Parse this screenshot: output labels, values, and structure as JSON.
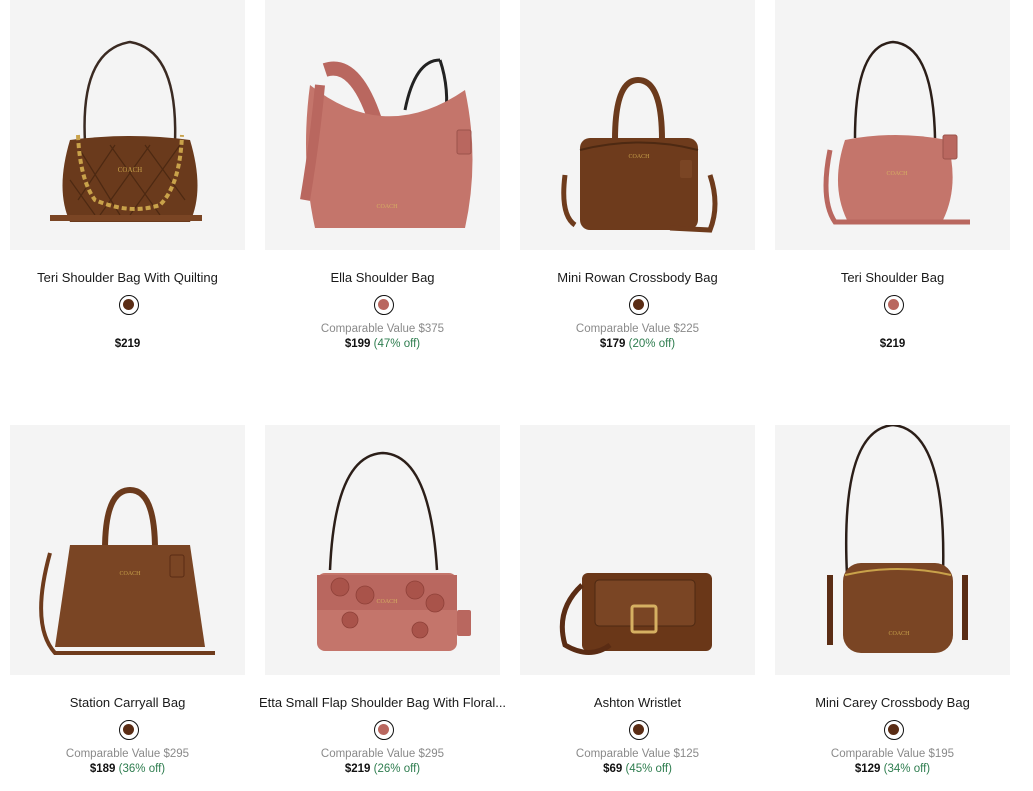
{
  "colors": {
    "tile_background": "#f4f4f4",
    "discount_text": "#2e7d4f",
    "compare_text": "#8a8a8a"
  },
  "products": [
    {
      "name": "Teri Shoulder Bag With Quilting",
      "swatch_color": "#5a2c14",
      "comparable_value": "",
      "price": "$219",
      "discount": "",
      "image": "brown-quilted-shoulder-bag-gold-chain"
    },
    {
      "name": "Ella Shoulder Bag",
      "swatch_color": "#b9675f",
      "comparable_value": "Comparable Value $375",
      "price": "$199",
      "discount": "(47% off)",
      "image": "pink-suede-hobo-shoulder-bag"
    },
    {
      "name": "Mini Rowan Crossbody Bag",
      "swatch_color": "#5a2c14",
      "comparable_value": "Comparable Value $225",
      "price": "$179",
      "discount": "(20% off)",
      "image": "brown-suede-barrel-crossbody-bag"
    },
    {
      "name": "Teri Shoulder Bag",
      "swatch_color": "#b9675f",
      "comparable_value": "",
      "price": "$219",
      "discount": "",
      "image": "pink-suede-shoulder-bag"
    },
    {
      "name": "Station Carryall Bag",
      "swatch_color": "#5a2c14",
      "comparable_value": "Comparable Value $295",
      "price": "$189",
      "discount": "(36% off)",
      "image": "brown-suede-carryall-tote"
    },
    {
      "name": "Etta Small Flap Shoulder Bag With Floral...",
      "swatch_color": "#b9675f",
      "comparable_value": "Comparable Value $295",
      "price": "$219",
      "discount": "(26% off)",
      "image": "pink-floral-applique-flap-bag"
    },
    {
      "name": "Ashton Wristlet",
      "swatch_color": "#5a2c14",
      "comparable_value": "Comparable Value $125",
      "price": "$69",
      "discount": "(45% off)",
      "image": "brown-suede-wristlet-buckle"
    },
    {
      "name": "Mini Carey Crossbody Bag",
      "swatch_color": "#5a2c14",
      "comparable_value": "Comparable Value $195",
      "price": "$129",
      "discount": "(34% off)",
      "image": "brown-suede-camera-crossbody"
    }
  ]
}
